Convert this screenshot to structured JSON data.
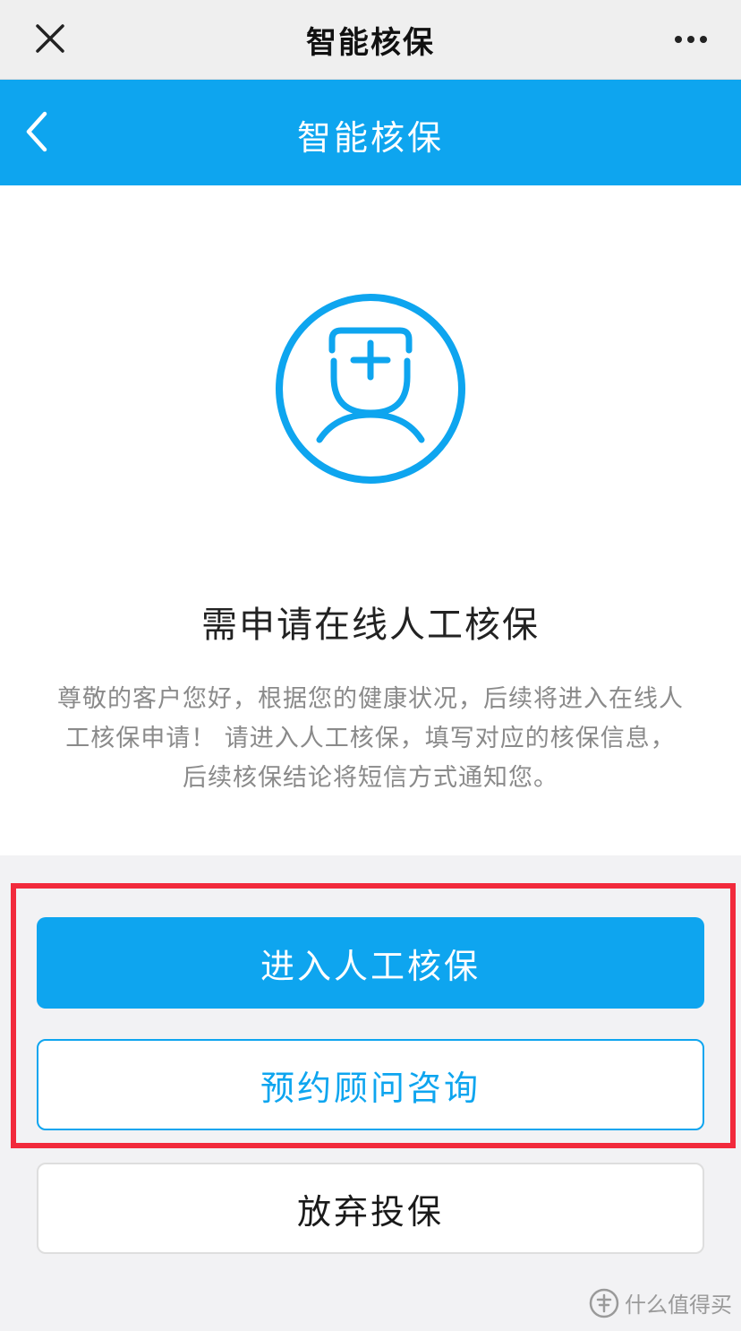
{
  "wechat_bar": {
    "title": "智能核保",
    "close_icon": "close-icon",
    "more_icon": "more-dots-icon"
  },
  "app_bar": {
    "title": "智能核保",
    "back_icon": "chevron-left-icon",
    "background": "#0ea5ef"
  },
  "hero": {
    "icon": "doctor-avatar-icon",
    "headline": "需申请在线人工核保",
    "description": "尊敬的客户您好，根据您的健康状况，后续将进入在线人工核保申请！ 请进入人工核保，填写对应的核保信息，后续核保结论将短信方式通知您。"
  },
  "actions": {
    "primary_label": "进入人工核保",
    "secondary_label": "预约顾问咨询",
    "abandon_label": "放弃投保"
  },
  "watermark": {
    "text": "什么值得买",
    "icon": "smzdm-logo-icon"
  },
  "colors": {
    "accent": "#0ea5ef",
    "highlight_border": "#f22a3c"
  }
}
